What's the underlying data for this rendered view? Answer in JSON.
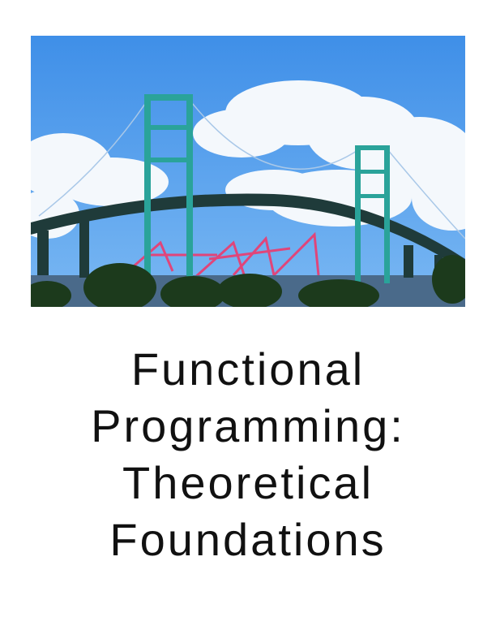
{
  "cover": {
    "photo": {
      "subject": "bridge-photo",
      "colors": {
        "sky_top": "#3f8fe8",
        "sky_bottom": "#6fb3f2",
        "cloud": "#f4f8fc",
        "tower": "#2aa39a",
        "deck": "#1f3b3a",
        "cranes": "#e0457a",
        "trees": "#1c3a1c"
      }
    },
    "title_lines": [
      "Functional",
      "Programming:",
      "Theoretical",
      "Foundations"
    ]
  }
}
